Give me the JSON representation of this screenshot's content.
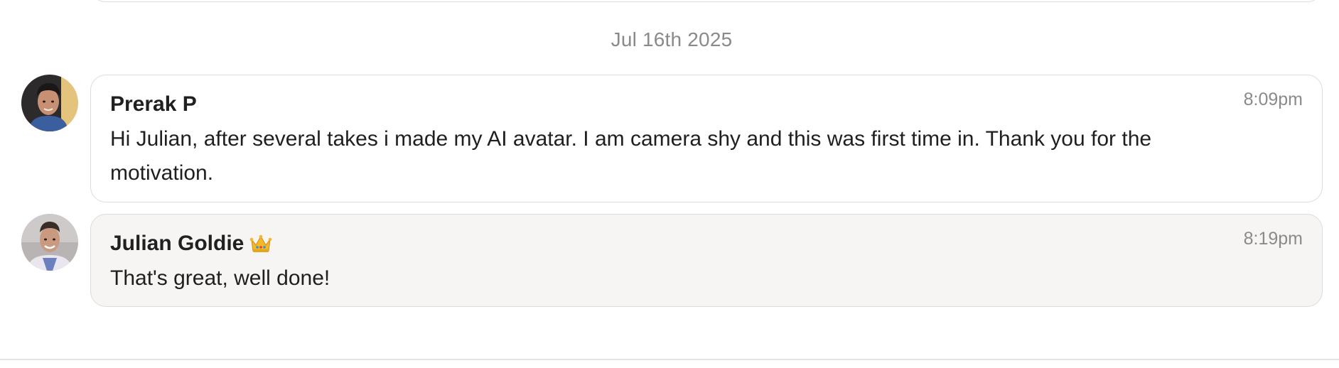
{
  "date_separator": "Jul 16th 2025",
  "messages": [
    {
      "sender": "Prerak P",
      "time": "8:09pm",
      "text": "Hi Julian, after several takes i made my AI avatar. I am camera shy and this was first time in. Thank you for the motivation.",
      "avatar_icon": "user-photo-avatar"
    },
    {
      "sender": "Julian Goldie",
      "badge_icon": "crown-icon",
      "time": "8:19pm",
      "text": "That's great, well done!",
      "avatar_icon": "user-photo-avatar"
    }
  ],
  "colors": {
    "bubble_border": "#dcdcdc",
    "reply_bubble_bg": "#f6f5f4",
    "muted_text": "#8a8a8a",
    "crown": "#f2b928"
  }
}
